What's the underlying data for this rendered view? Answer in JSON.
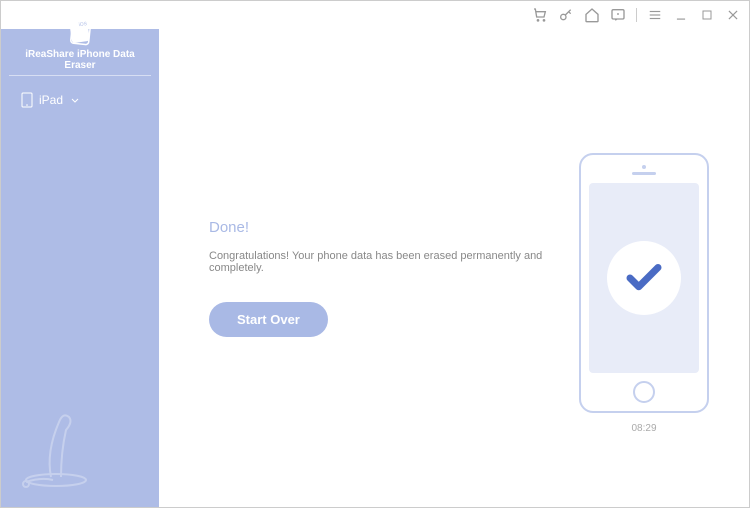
{
  "app": {
    "name": "iReaShare iPhone Data Eraser"
  },
  "sidebar": {
    "device": "iPad"
  },
  "main": {
    "title": "Done!",
    "message": "Congratulations! Your phone data has been erased permanently and completely.",
    "button": "Start Over",
    "time": "08:29"
  }
}
